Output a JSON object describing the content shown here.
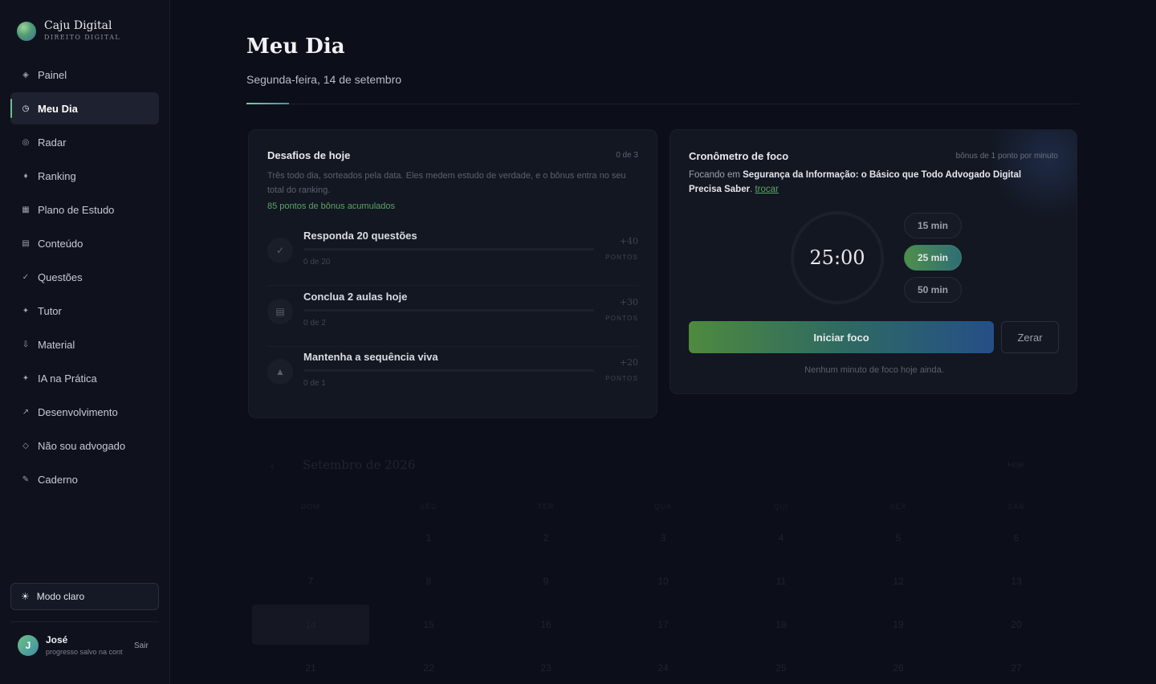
{
  "brand": {
    "name": "Caju Digital",
    "subtitle": "DIREITO DIGITAL"
  },
  "sidebar": {
    "items": [
      {
        "label": "Painel",
        "icon": "◈",
        "icon_name": "diamond-icon",
        "active": false
      },
      {
        "label": "Meu Dia",
        "icon": "◷",
        "icon_name": "clock-icon",
        "active": true
      },
      {
        "label": "Radar",
        "icon": "◎",
        "icon_name": "radar-icon",
        "active": false
      },
      {
        "label": "Ranking",
        "icon": "♦",
        "icon_name": "trophy-icon",
        "active": false
      },
      {
        "label": "Plano de Estudo",
        "icon": "▦",
        "icon_name": "calendar-icon",
        "active": false
      },
      {
        "label": "Conteúdo",
        "icon": "▤",
        "icon_name": "book-icon",
        "active": false
      },
      {
        "label": "Questões",
        "icon": "✓",
        "icon_name": "check-icon",
        "active": false
      },
      {
        "label": "Tutor",
        "icon": "✦",
        "icon_name": "sparkle-icon",
        "active": false
      },
      {
        "label": "Material",
        "icon": "⇩",
        "icon_name": "download-icon",
        "active": false
      },
      {
        "label": "IA na Prática",
        "icon": "✦",
        "icon_name": "ai-sparkle-icon",
        "active": false
      },
      {
        "label": "Desenvolvimento",
        "icon": "↗",
        "icon_name": "trend-icon",
        "active": false
      },
      {
        "label": "Não sou advogado",
        "icon": "◇",
        "icon_name": "diamond-outline-icon",
        "active": false
      },
      {
        "label": "Caderno",
        "icon": "✎",
        "icon_name": "pencil-icon",
        "active": false
      }
    ],
    "mode_button": {
      "label": "Modo claro",
      "icon": "☀"
    },
    "user": {
      "initial": "J",
      "name": "José",
      "status": "progresso salvo na cont",
      "logout": "Sair"
    }
  },
  "header": {
    "title": "Meu Dia",
    "date": "Segunda-feira, 14 de setembro"
  },
  "challenges": {
    "title": "Desafios de hoje",
    "count": "0 de 3",
    "description": "Três todo dia, sorteados pela data. Eles medem estudo de verdade, e o bônus entra no seu total do ranking.",
    "bonus": "85 pontos de bônus acumulados",
    "items": [
      {
        "name": "Responda 20 questões",
        "progress": "0 de 20",
        "progress_fraction": 0,
        "points": "+40",
        "points_label": "PONTOS",
        "icon": "✓",
        "icon_name": "check-icon"
      },
      {
        "name": "Conclua 2 aulas hoje",
        "progress": "0 de 2",
        "progress_fraction": 0,
        "points": "+30",
        "points_label": "PONTOS",
        "icon": "▤",
        "icon_name": "lesson-icon"
      },
      {
        "name": "Mantenha a sequência viva",
        "progress": "0 de 1",
        "progress_fraction": 0,
        "points": "+20",
        "points_label": "PONTOS",
        "icon": "▲",
        "icon_name": "flame-icon"
      }
    ]
  },
  "focus": {
    "title": "Cronômetro de foco",
    "bonus_note": "bônus de 1 ponto por minuto",
    "focus_prefix": "Focando em",
    "topic": "Segurança da Informação: o Básico que Todo Advogado Digital Precisa Saber",
    "swap": "trocar",
    "timer": "25:00",
    "durations": [
      {
        "label": "15 min",
        "selected": false
      },
      {
        "label": "25 min",
        "selected": true
      },
      {
        "label": "50 min",
        "selected": false
      }
    ],
    "start": "Iniciar foco",
    "reset": "Zerar",
    "status": "Nenhum minuto de foco hoje ainda."
  },
  "calendar": {
    "prev": "‹",
    "title": "Setembro de 2026",
    "today_button": "Hoje",
    "weekdays": [
      "DOM",
      "SEG",
      "TER",
      "QUA",
      "QUI",
      "SEX",
      "SÁB"
    ],
    "weeks": [
      [
        "",
        "1",
        "2",
        "3",
        "4",
        "5",
        "6"
      ],
      [
        "7",
        "8",
        "9",
        "10",
        "11",
        "12",
        "13"
      ],
      [
        "14",
        "15",
        "16",
        "17",
        "18",
        "19",
        "20"
      ],
      [
        "21",
        "22",
        "23",
        "24",
        "25",
        "26",
        "27"
      ]
    ],
    "today": "14"
  }
}
